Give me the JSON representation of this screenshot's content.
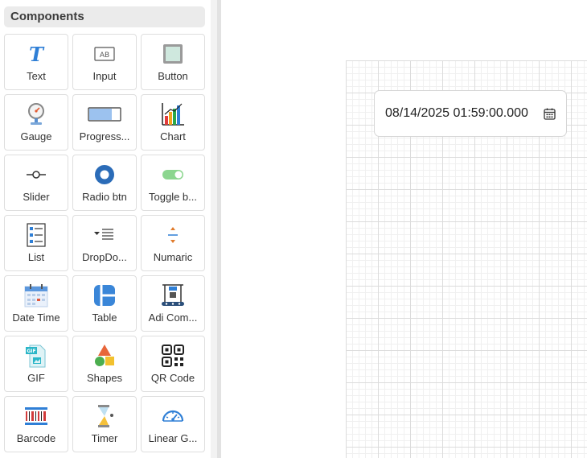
{
  "panel": {
    "title": "Components",
    "items": [
      {
        "label": "Text",
        "icon": "text-icon"
      },
      {
        "label": "Input",
        "icon": "input-icon"
      },
      {
        "label": "Button",
        "icon": "button-icon"
      },
      {
        "label": "Gauge",
        "icon": "gauge-icon"
      },
      {
        "label": "Progress...",
        "icon": "progress-icon"
      },
      {
        "label": "Chart",
        "icon": "chart-icon"
      },
      {
        "label": "Slider",
        "icon": "slider-icon"
      },
      {
        "label": "Radio btn",
        "icon": "radio-icon"
      },
      {
        "label": "Toggle b...",
        "icon": "toggle-icon"
      },
      {
        "label": "List",
        "icon": "list-icon"
      },
      {
        "label": "DropDo...",
        "icon": "dropdown-icon"
      },
      {
        "label": "Numaric",
        "icon": "numeric-icon"
      },
      {
        "label": "Date Time",
        "icon": "calendar-icon"
      },
      {
        "label": "Table",
        "icon": "table-icon"
      },
      {
        "label": "Adi Com...",
        "icon": "conveyor-icon"
      },
      {
        "label": "GIF",
        "icon": "gif-icon"
      },
      {
        "label": "Shapes",
        "icon": "shapes-icon"
      },
      {
        "label": "QR Code",
        "icon": "qr-code-icon"
      },
      {
        "label": "Barcode",
        "icon": "barcode-icon"
      },
      {
        "label": "Timer",
        "icon": "hourglass-icon"
      },
      {
        "label": "Linear G...",
        "icon": "speedometer-icon"
      }
    ]
  },
  "canvas": {
    "datetime_widget": {
      "value": "08/14/2025 01:59:00.000",
      "icon": "calendar-icon"
    }
  },
  "colors": {
    "accent_blue": "#2f7fd6",
    "panel_header_bg": "#ebebeb",
    "grid_major": "#dcdcdc",
    "grid_minor": "#f0f0f0"
  }
}
